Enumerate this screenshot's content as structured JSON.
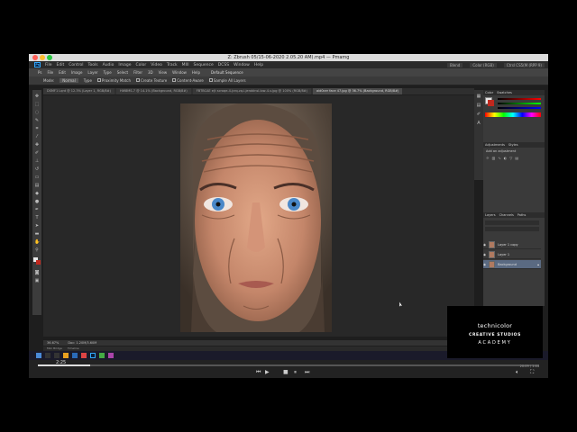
{
  "window": {
    "title": "Z: Zbrush 05/15-06-2020 2.05.20 AM).mp4 — Pmamg"
  },
  "menu": {
    "logo": "Ps",
    "items": [
      "File",
      "Edit",
      "Control",
      "Tools",
      "Audio",
      "Image",
      "Color",
      "Video",
      "Track",
      "MIII",
      "Sequence",
      "DCSS",
      "Window",
      "Help"
    ],
    "right_items": [
      "Blend",
      "Color (RGB)",
      "Ctrsl CS5(M (RPP 9)"
    ]
  },
  "subbar": {
    "items": [
      "Ps",
      "File",
      "Edit",
      "Image",
      "Layer",
      "Type",
      "Select",
      "Filter",
      "3D",
      "View",
      "Window",
      "Help"
    ],
    "label": "Default Sequence"
  },
  "options": {
    "items": [
      "Mode:",
      "Normal",
      "Type",
      "Proximity Match",
      "Create Texture",
      "Content-Aware",
      "Sample All Layers"
    ]
  },
  "doc_tabs": [
    {
      "label": "DSMF1 Lqrd @ 12.3% (Layer 1, RGB/8#)"
    },
    {
      "label": "HW8MS-7 @ 14.1% (Background, RGB/8#)"
    },
    {
      "label": "FBTBCAE e(t scroqe-4-jcrq-zq-i-jeroblnsl-low-4-v.jpg @ 100% (RGB/8#)"
    },
    {
      "label": "aid0cer face 47.jpg @ 36.7% (Background, RGB/8#)"
    }
  ],
  "status": {
    "zoom": "36.67%",
    "doc": "Doc: 1.20M/3.60M"
  },
  "mini_tabs": [
    "Mini Bridge",
    "Timeline"
  ],
  "panels": {
    "top_tabs": [
      "Color",
      "Swatches"
    ],
    "adj_tabs": [
      "Adjustments",
      "Styles"
    ],
    "adj_label": "Add an adjustment",
    "layer_tabs": [
      "Layers",
      "Channels",
      "Paths"
    ],
    "layers": [
      {
        "name": "Layer 1 copy",
        "selected": false
      },
      {
        "name": "Layer 1",
        "selected": false
      },
      {
        "name": "Background",
        "selected": true
      }
    ]
  },
  "player": {
    "time_left": "2:25",
    "time_right": "20:09 / 1:44",
    "progress": 0.105
  },
  "brand": {
    "line1": "technicolor",
    "line2": "CREATIVE STUDIOS",
    "line3": "ACADEMY"
  },
  "colors": {
    "ps_blue": "#31a8ff",
    "panel_bg": "#3a3a3a",
    "selected_layer": "#5a6a82"
  },
  "icons": [
    "play-icon",
    "pause-icon",
    "stop-icon",
    "prev-icon",
    "next-icon",
    "volume-icon",
    "fullscreen-icon",
    "move-tool-icon",
    "brush-tool-icon",
    "eye-icon",
    "search-icon",
    "windows-start-icon"
  ]
}
